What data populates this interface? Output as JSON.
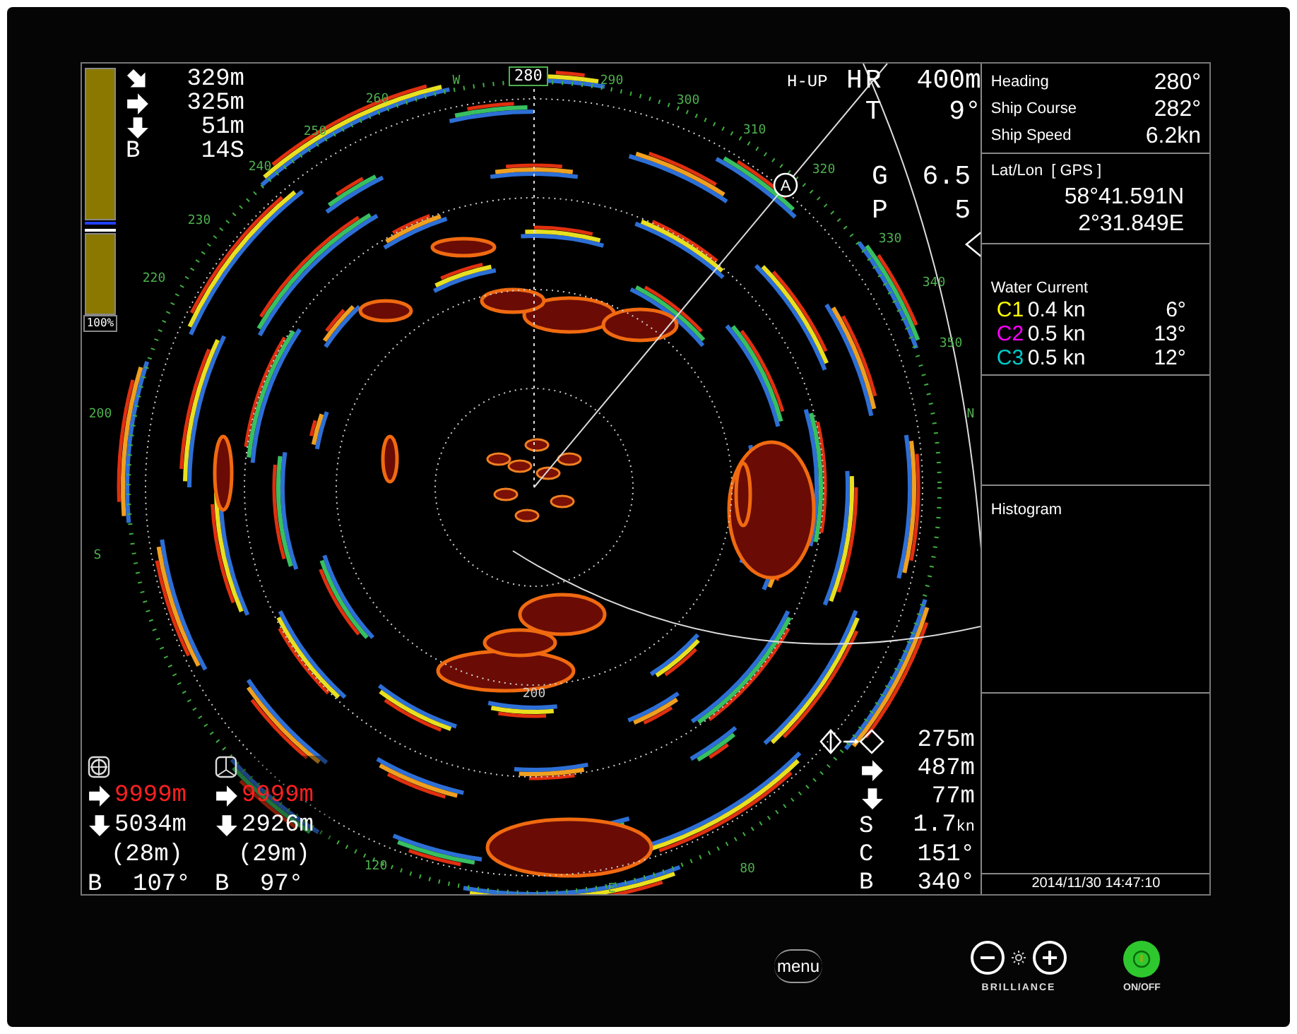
{
  "bearing_scale": {
    "heading_marker": "280",
    "labels": [
      {
        "label": "S"
      },
      {
        "label": "200"
      },
      {
        "label": "220"
      },
      {
        "label": "230"
      },
      {
        "label": "240"
      },
      {
        "label": "250"
      },
      {
        "label": "260"
      },
      {
        "label": "W"
      },
      {
        "label": "290"
      },
      {
        "label": "300"
      },
      {
        "label": "310"
      },
      {
        "label": "320"
      },
      {
        "label": "330"
      },
      {
        "label": "340"
      },
      {
        "label": "350"
      },
      {
        "label": "N"
      },
      {
        "label": "120"
      },
      {
        "label": "E"
      },
      {
        "label": "80"
      }
    ]
  },
  "range_ring_label": "200",
  "target_marker": "A",
  "gain_bar": {
    "label": "100%"
  },
  "top_left_readout": [
    {
      "kind": "arrow-down-right",
      "value": "329m"
    },
    {
      "kind": "arrow-right",
      "value": "325m"
    },
    {
      "kind": "arrow-down",
      "value": "51m"
    },
    {
      "kind": "letter",
      "letter": "B",
      "value": "14S"
    }
  ],
  "mode_indicator": "H-UP",
  "top_right_readout": {
    "mode_letter": "H",
    "rows_upper": [
      {
        "letter": "R",
        "value": "400m"
      },
      {
        "letter": "T",
        "value": "9°"
      }
    ],
    "rows_lower": [
      {
        "letter": "G",
        "value": "6.5"
      },
      {
        "letter": "P",
        "value": "5"
      }
    ]
  },
  "bottom_left_readouts": [
    {
      "rows": [
        {
          "kind": "arrow-right",
          "value": "9999m",
          "alert": true
        },
        {
          "kind": "arrow-down",
          "value": "5034m",
          "alert": false
        },
        {
          "kind": "plain",
          "value": "(28m)",
          "alert": false
        },
        {
          "kind": "letter",
          "letter": "B",
          "value": "107°",
          "alert": false
        }
      ]
    },
    {
      "rows": [
        {
          "kind": "arrow-right",
          "value": "9999m",
          "alert": true
        },
        {
          "kind": "arrow-down",
          "value": "2926m",
          "alert": false
        },
        {
          "kind": "plain",
          "value": "(29m)",
          "alert": false
        },
        {
          "kind": "letter",
          "letter": "B",
          "value": "97°",
          "alert": false
        }
      ]
    }
  ],
  "bottom_right_readout": [
    {
      "kind": "diamond-transfer",
      "value": "275m"
    },
    {
      "kind": "arrow-right",
      "value": "487m"
    },
    {
      "kind": "arrow-down",
      "value": "77m"
    },
    {
      "kind": "letter",
      "letter": "S",
      "value": "1.7",
      "unit": "kn"
    },
    {
      "kind": "letter",
      "letter": "C",
      "value": "151°"
    },
    {
      "kind": "letter",
      "letter": "B",
      "value": "340°"
    }
  ],
  "info_panel": {
    "ship": [
      {
        "label": "Heading",
        "value": "280°"
      },
      {
        "label": "Ship Course",
        "value": "282°"
      },
      {
        "label": "Ship Speed",
        "value": "6.2kn"
      }
    ],
    "position": {
      "title": "Lat/Lon",
      "source": "[ GPS ]",
      "lat": "58°41.591N",
      "lon": "2°31.849E"
    },
    "water_current": {
      "title": "Water Current",
      "layers": [
        {
          "name": "C1",
          "speed": "0.4 kn",
          "direction": "6°",
          "color": "#ffff00"
        },
        {
          "name": "C2",
          "speed": "0.5 kn",
          "direction": "13°",
          "color": "#ff00ff"
        },
        {
          "name": "C3",
          "speed": "0.5 kn",
          "direction": "12°",
          "color": "#00cccc"
        }
      ]
    },
    "histogram": {
      "title": "Histogram"
    },
    "datetime": "2014/11/30 14:47:10"
  },
  "bezel": {
    "menu_button": "menu",
    "brilliance": {
      "label": "BRILLIANCE"
    },
    "power": {
      "label": "ON/OFF",
      "on": true
    }
  }
}
